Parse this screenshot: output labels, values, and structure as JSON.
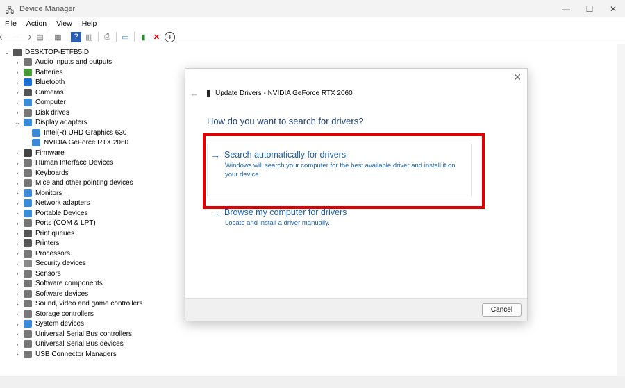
{
  "window": {
    "title": "Device Manager",
    "minimize": "—",
    "maximize": "☐",
    "close": "✕"
  },
  "menu": [
    "File",
    "Action",
    "View",
    "Help"
  ],
  "toolbar": {
    "back": "🡐",
    "forward": "🡒",
    "remove": "✕",
    "download": "⬇"
  },
  "tree": {
    "root": "DESKTOP-ETFB5ID",
    "items": [
      {
        "label": "Audio inputs and outputs",
        "expanded": false
      },
      {
        "label": "Batteries",
        "expanded": false
      },
      {
        "label": "Bluetooth",
        "expanded": false
      },
      {
        "label": "Cameras",
        "expanded": false
      },
      {
        "label": "Computer",
        "expanded": false
      },
      {
        "label": "Disk drives",
        "expanded": false
      },
      {
        "label": "Display adapters",
        "expanded": true,
        "children": [
          "Intel(R) UHD Graphics 630",
          "NVIDIA GeForce RTX 2060"
        ]
      },
      {
        "label": "Firmware",
        "expanded": false
      },
      {
        "label": "Human Interface Devices",
        "expanded": false
      },
      {
        "label": "Keyboards",
        "expanded": false
      },
      {
        "label": "Mice and other pointing devices",
        "expanded": false
      },
      {
        "label": "Monitors",
        "expanded": false
      },
      {
        "label": "Network adapters",
        "expanded": false
      },
      {
        "label": "Portable Devices",
        "expanded": false
      },
      {
        "label": "Ports (COM & LPT)",
        "expanded": false
      },
      {
        "label": "Print queues",
        "expanded": false
      },
      {
        "label": "Printers",
        "expanded": false
      },
      {
        "label": "Processors",
        "expanded": false
      },
      {
        "label": "Security devices",
        "expanded": false
      },
      {
        "label": "Sensors",
        "expanded": false
      },
      {
        "label": "Software components",
        "expanded": false
      },
      {
        "label": "Software devices",
        "expanded": false
      },
      {
        "label": "Sound, video and game controllers",
        "expanded": false
      },
      {
        "label": "Storage controllers",
        "expanded": false
      },
      {
        "label": "System devices",
        "expanded": false
      },
      {
        "label": "Universal Serial Bus controllers",
        "expanded": false
      },
      {
        "label": "Universal Serial Bus devices",
        "expanded": false
      },
      {
        "label": "USB Connector Managers",
        "expanded": false
      }
    ]
  },
  "dialog": {
    "title": "Update Drivers - NVIDIA GeForce RTX 2060",
    "question": "How do you want to search for drivers?",
    "option1": {
      "label": "Search automatically for drivers",
      "desc": "Windows will search your computer for the best available driver and install it on your device."
    },
    "option2": {
      "label": "Browse my computer for drivers",
      "desc": "Locate and install a driver manually."
    },
    "cancel": "Cancel",
    "close": "✕",
    "back": "←",
    "arrow": "→"
  },
  "colors": {
    "highlight": "#e00000",
    "link": "#1a5fa8"
  }
}
